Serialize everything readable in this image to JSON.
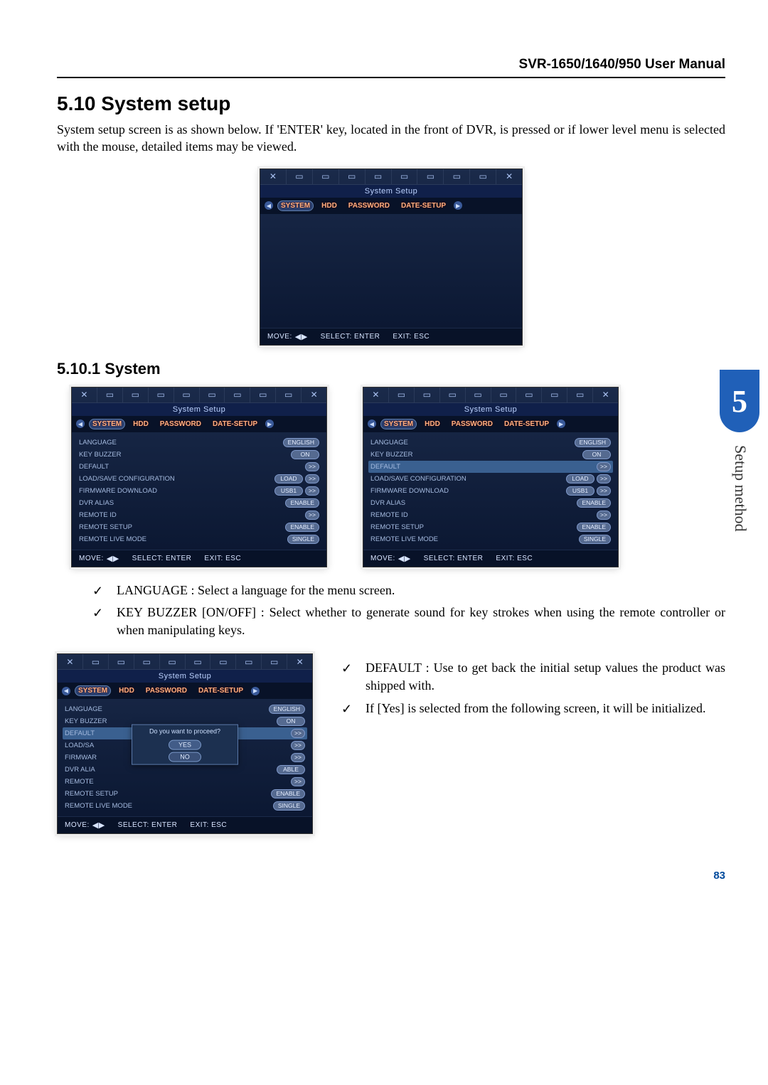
{
  "header": {
    "title": "SVR-1650/1640/950 User Manual"
  },
  "sec1": {
    "num": "5.10",
    "title": "System setup",
    "desc": "System setup screen is as shown below. If 'ENTER' key, located in the front of DVR, is pressed or if lower level menu is selected with the mouse, detailed items may be viewed."
  },
  "sec2": {
    "num": "5.10.1",
    "title": "System"
  },
  "panel_common": {
    "title": "System Setup",
    "tabs": [
      "SYSTEM",
      "HDD",
      "PASSWORD",
      "DATE-SETUP"
    ],
    "footer": {
      "move": "MOVE:",
      "select": "SELECT: ENTER",
      "exit": "EXIT: ESC"
    }
  },
  "rows_a": [
    {
      "label": "LANGUAGE",
      "vals": [
        "ENGLISH"
      ]
    },
    {
      "label": "KEY BUZZER",
      "vals": [
        "ON"
      ]
    },
    {
      "label": "DEFAULT",
      "vals": [
        ">>"
      ]
    },
    {
      "label": "LOAD/SAVE CONFIGURATION",
      "vals": [
        "LOAD",
        ">>"
      ]
    },
    {
      "label": "FIRMWARE DOWNLOAD",
      "vals": [
        "USB1",
        ">>"
      ]
    },
    {
      "label": "DVR ALIAS",
      "vals": [
        "ENABLE"
      ]
    },
    {
      "label": "REMOTE ID",
      "vals": [
        ">>"
      ]
    },
    {
      "label": "REMOTE SETUP",
      "vals": [
        "ENABLE"
      ]
    },
    {
      "label": "REMOTE LIVE MODE",
      "vals": [
        "SINGLE"
      ]
    }
  ],
  "rows_b": [
    {
      "label": "LANGUAGE",
      "vals": [
        "ENGLISH"
      ]
    },
    {
      "label": "KEY BUZZER",
      "vals": [
        "ON"
      ]
    },
    {
      "label": "DEFAULT",
      "vals": [
        ">>"
      ],
      "hl": true
    },
    {
      "label": "LOAD/SAVE CONFIGURATION",
      "vals": [
        "LOAD",
        ">>"
      ]
    },
    {
      "label": "FIRMWARE DOWNLOAD",
      "vals": [
        "USB1",
        ">>"
      ]
    },
    {
      "label": "DVR ALIAS",
      "vals": [
        "ENABLE"
      ]
    },
    {
      "label": "REMOTE ID",
      "vals": [
        ">>"
      ]
    },
    {
      "label": "REMOTE SETUP",
      "vals": [
        "ENABLE"
      ]
    },
    {
      "label": "REMOTE LIVE MODE",
      "vals": [
        "SINGLE"
      ]
    }
  ],
  "rows_c": [
    {
      "label": "LANGUAGE",
      "vals": [
        "ENGLISH"
      ]
    },
    {
      "label": "KEY BUZZER",
      "vals": [
        "ON"
      ]
    },
    {
      "label": "DEFAULT",
      "vals": [
        ">>"
      ],
      "hl": true
    },
    {
      "label": "LOAD/SA",
      "vals": [
        ">>"
      ]
    },
    {
      "label": "FIRMWAR",
      "vals": [
        ">>"
      ]
    },
    {
      "label": "DVR ALIA",
      "vals": [
        "ABLE"
      ]
    },
    {
      "label": "REMOTE",
      "vals": [
        ">>"
      ]
    },
    {
      "label": "REMOTE SETUP",
      "vals": [
        "ENABLE"
      ]
    },
    {
      "label": "REMOTE LIVE MODE",
      "vals": [
        "SINGLE"
      ]
    }
  ],
  "dialog": {
    "text": "Do you want to proceed?",
    "yes": "YES",
    "no": "NO"
  },
  "bullets1": [
    "LANGUAGE : Select a language for the menu screen.",
    "KEY BUZZER [ON/OFF] : Select whether to generate sound for key strokes when using the remote controller or when manipulating keys."
  ],
  "bullets2": [
    "DEFAULT : Use to get back the initial setup values the product was shipped with.",
    "If [Yes] is selected from the following screen, it will be initialized."
  ],
  "side": {
    "num": "5",
    "text": "Setup method"
  },
  "page": "83",
  "icons": [
    "✕",
    "▭",
    "▭",
    "▭",
    "▭",
    "▭",
    "▭",
    "▭",
    "▭",
    "✕"
  ]
}
